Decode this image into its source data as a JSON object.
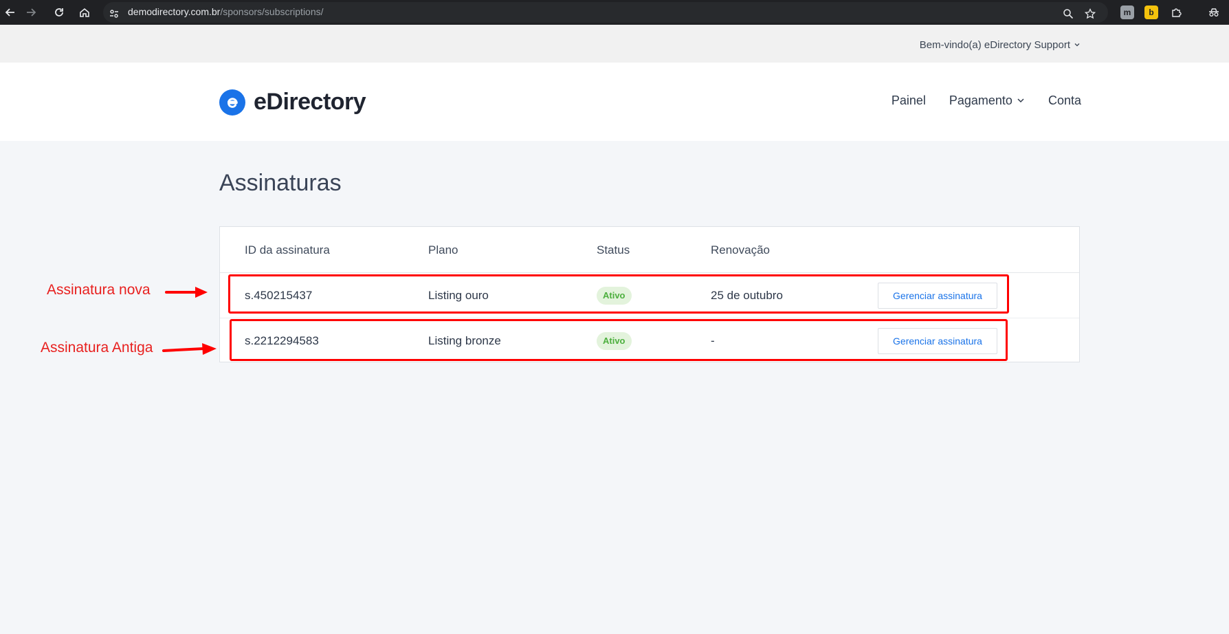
{
  "browser": {
    "url_host": "demodirectory.com.br",
    "url_path": "/sponsors/subscriptions/"
  },
  "header": {
    "welcome": "Bem-vindo(a) eDirectory Support",
    "logo_text": "eDirectory",
    "nav": {
      "painel": "Painel",
      "pagamento": "Pagamento",
      "conta": "Conta"
    }
  },
  "main": {
    "title": "Assinaturas",
    "columns": [
      "ID da assinatura",
      "Plano",
      "Status",
      "Renovação"
    ],
    "rows": [
      {
        "id": "s.450215437",
        "plan": "Listing ouro",
        "status": "Ativo",
        "renewal": "25 de outubro",
        "action": "Gerenciar assinatura"
      },
      {
        "id": "s.2212294583",
        "plan": "Listing bronze",
        "status": "Ativo",
        "renewal": "-",
        "action": "Gerenciar assinatura"
      }
    ]
  },
  "annotations": {
    "new": "Assinatura nova",
    "old": "Assinatura Antiga",
    "color": "#ff0000"
  },
  "colors": {
    "brand": "#1a73e8",
    "status_active_bg": "#e3f3dc",
    "status_active_text": "#4caf3d"
  },
  "icons": [
    "back-arrow-icon",
    "forward-arrow-icon",
    "reload-icon",
    "home-icon",
    "site-info-icon",
    "zoom-icon",
    "star-icon",
    "extension-m-icon",
    "extension-b-icon",
    "extensions-puzzle-icon",
    "incognito-icon",
    "chevron-down-icon",
    "arrow-right-icon"
  ]
}
